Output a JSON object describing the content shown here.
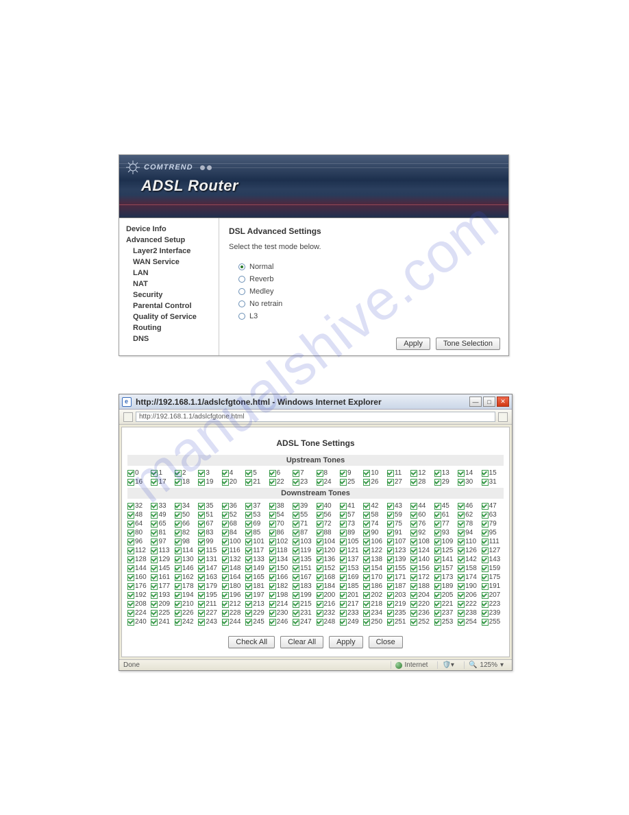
{
  "banner": {
    "brand": "COMTREND",
    "title": "ADSL Router"
  },
  "sidebar": {
    "items": [
      {
        "label": "Device Info",
        "bold": true,
        "sub": false
      },
      {
        "label": "Advanced Setup",
        "bold": true,
        "sub": false
      },
      {
        "label": "Layer2 Interface",
        "bold": true,
        "sub": true
      },
      {
        "label": "WAN Service",
        "bold": true,
        "sub": true
      },
      {
        "label": "LAN",
        "bold": true,
        "sub": true
      },
      {
        "label": "NAT",
        "bold": true,
        "sub": true
      },
      {
        "label": "Security",
        "bold": true,
        "sub": true
      },
      {
        "label": "Parental Control",
        "bold": true,
        "sub": true
      },
      {
        "label": "Quality of Service",
        "bold": true,
        "sub": true
      },
      {
        "label": "Routing",
        "bold": true,
        "sub": true
      },
      {
        "label": "DNS",
        "bold": true,
        "sub": true
      }
    ]
  },
  "dsl": {
    "heading": "DSL Advanced Settings",
    "instruction": "Select the test mode below.",
    "options": [
      {
        "label": "Normal",
        "selected": true
      },
      {
        "label": "Reverb",
        "selected": false
      },
      {
        "label": "Medley",
        "selected": false
      },
      {
        "label": "No retrain",
        "selected": false
      },
      {
        "label": "L3",
        "selected": false
      }
    ],
    "apply_label": "Apply",
    "tone_sel_label": "Tone Selection"
  },
  "tone_window": {
    "title": "http://192.168.1.1/adslcfgtone.html - Windows Internet Explorer",
    "url": "http://192.168.1.1/adslcfgtone.html",
    "heading": "ADSL Tone Settings",
    "upstream_label": "Upstream Tones",
    "downstream_label": "Downstream Tones",
    "upstream_start": 0,
    "upstream_end": 31,
    "downstream_start": 32,
    "downstream_end": 255,
    "check_all_label": "Check All",
    "clear_all_label": "Clear All",
    "apply_label": "Apply",
    "close_label": "Close",
    "status_left": "Done",
    "status_zone": "Internet",
    "status_zoom": "125%"
  },
  "watermark": "manualshive.com"
}
